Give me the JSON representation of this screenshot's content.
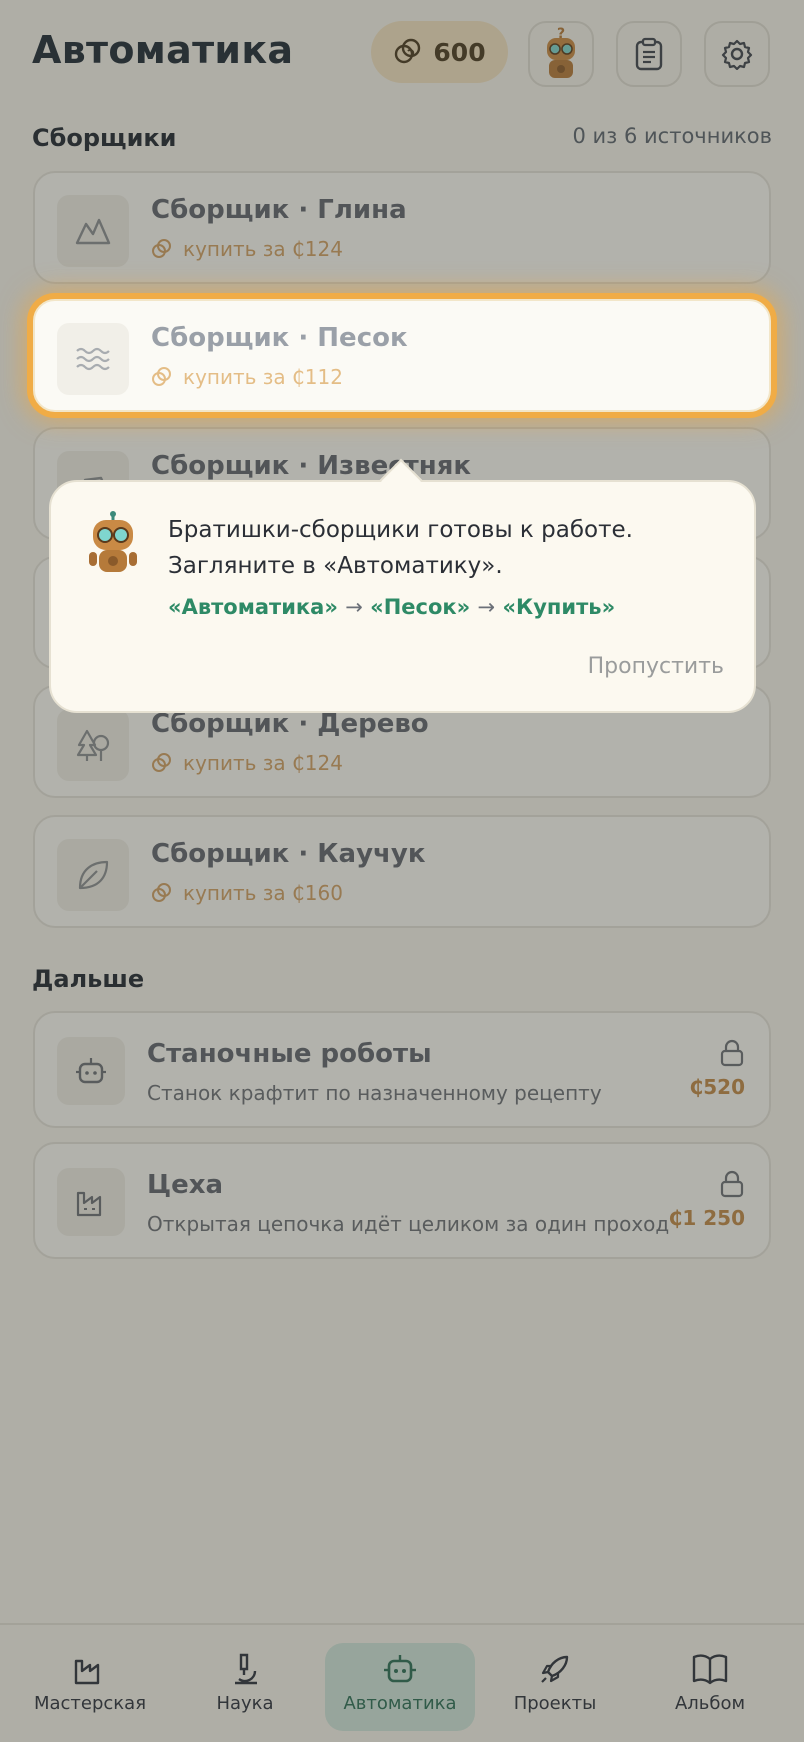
{
  "header": {
    "title": "Автоматика",
    "coins": "600"
  },
  "collectors": {
    "title": "Сборщики",
    "meta": "0 из 6 источников",
    "items": [
      {
        "name": "Сборщик · Глина",
        "price": "купить за ₵124",
        "icon": "mountain-icon"
      },
      {
        "name": "Сборщик · Песок",
        "price": "купить за ₵112",
        "icon": "waves-icon"
      },
      {
        "name": "Сборщик · Известняк",
        "icon": "stone-icon"
      },
      {
        "name": "Сборщик · Дерево",
        "price": "купить за ₵124",
        "icon": "tree-icon"
      },
      {
        "name": "Сборщик · Каучук",
        "price": "купить за ₵160",
        "icon": "leaf-icon"
      }
    ]
  },
  "next": {
    "title": "Дальше",
    "items": [
      {
        "name": "Станочные роботы",
        "desc": "Станок крафтит по назначенному рецепту",
        "price": "₵520",
        "icon": "robot-icon"
      },
      {
        "name": "Цеха",
        "desc": "Открытая цепочка идёт целиком за один проход",
        "price": "₵1 250",
        "icon": "factory-icon"
      }
    ]
  },
  "tooltip": {
    "line1": "Братишки-сборщики готовы к работе.",
    "line2": "Загляните в «Автоматику».",
    "step1": "«Автоматика»",
    "step2": "«Песок»",
    "step3": "«Купить»",
    "arrow": "→",
    "skip": "Пропустить"
  },
  "nav": {
    "items": [
      {
        "label": "Мастерская"
      },
      {
        "label": "Наука"
      },
      {
        "label": "Автоматика"
      },
      {
        "label": "Проекты"
      },
      {
        "label": "Альбом"
      }
    ],
    "active": "Автоматика"
  },
  "colors": {
    "accent": "#2e8a66",
    "highlight": "#f0ac46",
    "price": "#d0a066",
    "background": "#f6f4ee"
  }
}
